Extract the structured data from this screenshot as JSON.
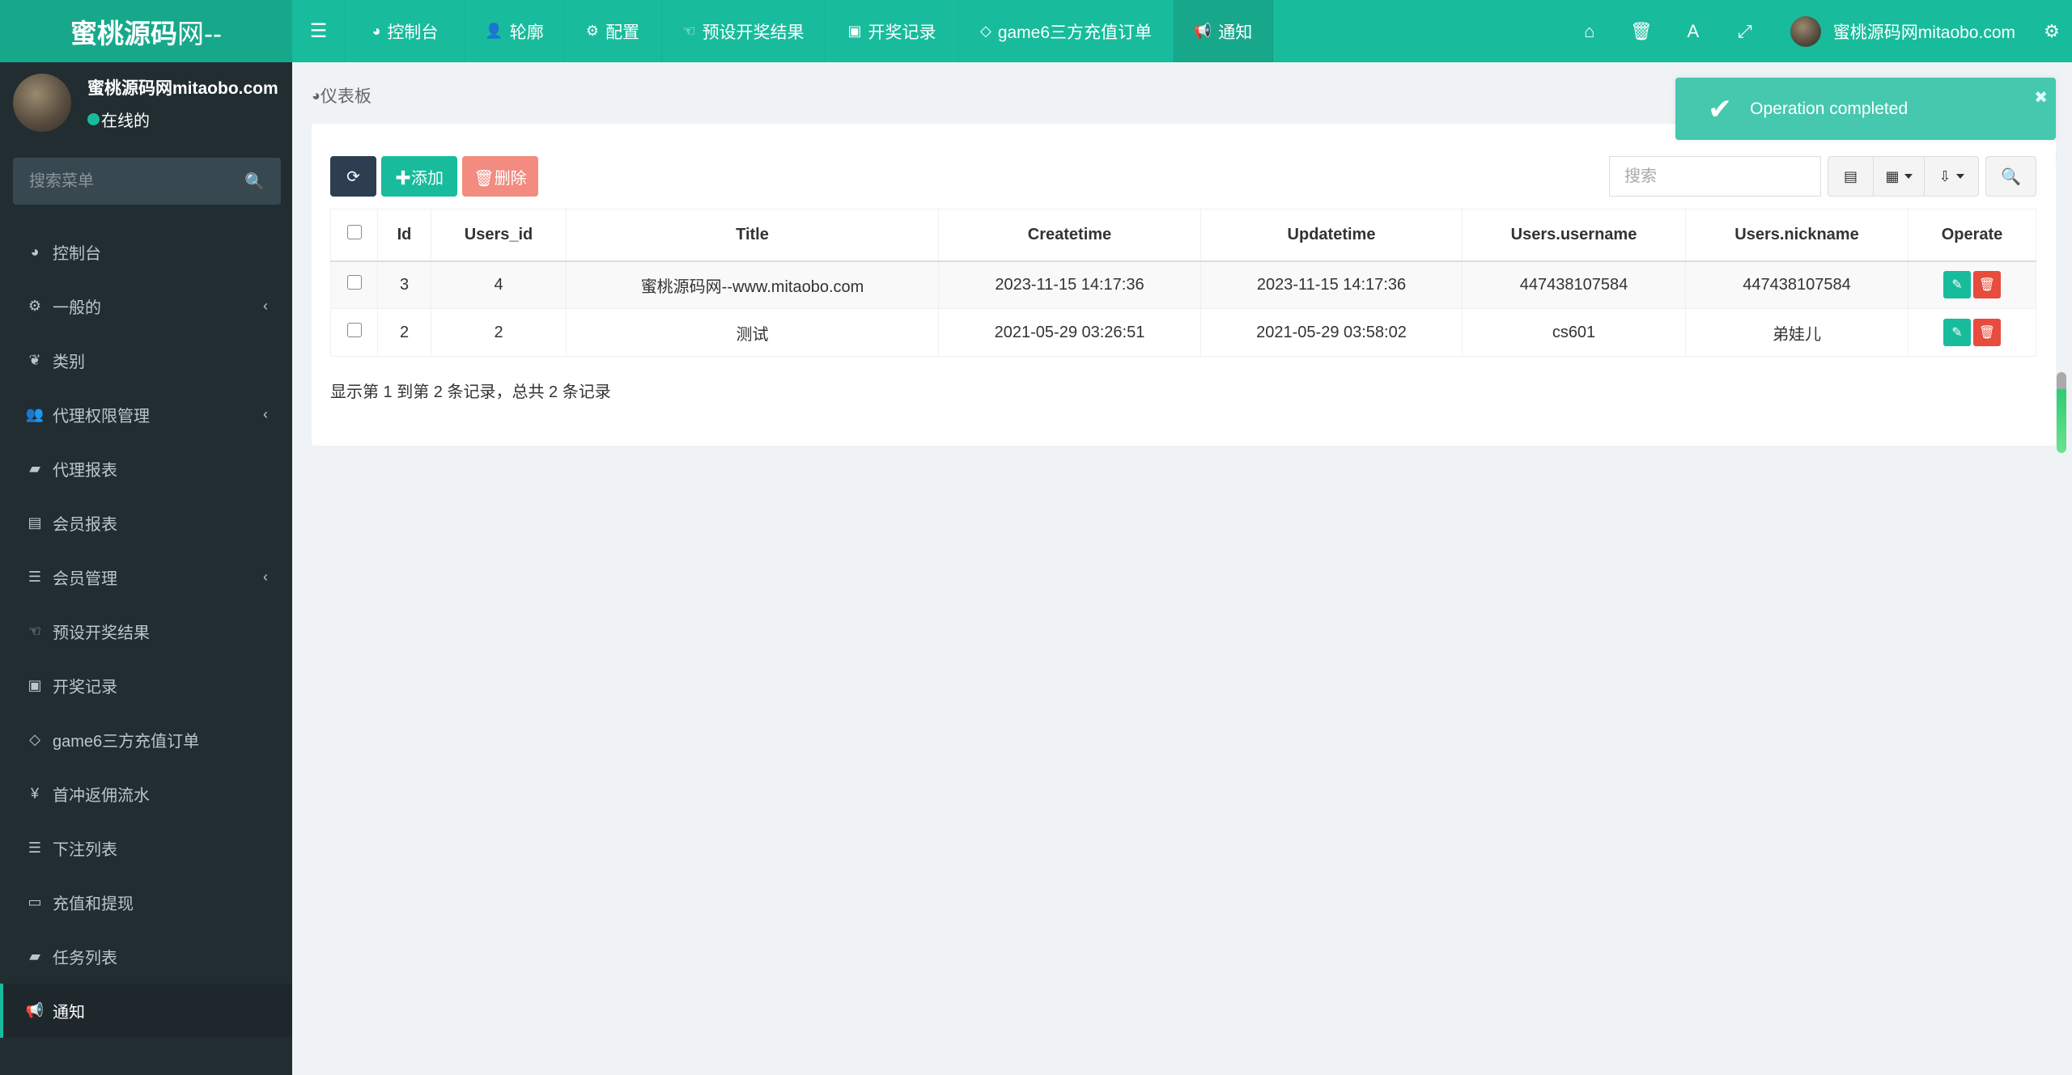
{
  "header": {
    "logo_bold": "蜜桃源码",
    "logo_thin": "网--",
    "nav": [
      {
        "icon": "dashboard-icon",
        "glyph": "◕",
        "label": "控制台"
      },
      {
        "icon": "user-icon",
        "glyph": "👤",
        "label": "轮廓"
      },
      {
        "icon": "gear-icon",
        "glyph": "⚙",
        "label": "配置"
      },
      {
        "icon": "hand-icon",
        "glyph": "☜",
        "label": "预设开奖结果"
      },
      {
        "icon": "calendar-check-icon",
        "glyph": "▣",
        "label": "开奖记录"
      },
      {
        "icon": "diamond-icon",
        "glyph": "◇",
        "label": "game6三方充值订单"
      },
      {
        "icon": "bullhorn-icon",
        "glyph": "📢",
        "label": "通知",
        "active": true
      }
    ],
    "right_icons": [
      {
        "icon": "home-icon",
        "glyph": "⌂"
      },
      {
        "icon": "trash-icon",
        "glyph": "🗑"
      },
      {
        "icon": "translate-icon",
        "glyph": "A"
      },
      {
        "icon": "fullscreen-icon",
        "glyph": "⤢"
      }
    ],
    "user_name": "蜜桃源码网mitaobo.com",
    "settings_icon": "gears-icon"
  },
  "sidebar": {
    "user_name": "蜜桃源码网mitaobo.com",
    "status": "在线的",
    "search_placeholder": "搜索菜单",
    "items": [
      {
        "icon": "dashboard-icon",
        "glyph": "◕",
        "label": "控制台"
      },
      {
        "icon": "gears-icon",
        "glyph": "⚙",
        "label": "一般的",
        "has_children": true
      },
      {
        "icon": "leaf-icon",
        "glyph": "❦",
        "label": "类别"
      },
      {
        "icon": "users-icon",
        "glyph": "👥",
        "label": "代理权限管理",
        "has_children": true
      },
      {
        "icon": "book-icon",
        "glyph": "▰",
        "label": "代理报表"
      },
      {
        "icon": "address-book-icon",
        "glyph": "▤",
        "label": "会员报表"
      },
      {
        "icon": "list-icon",
        "glyph": "☰",
        "label": "会员管理",
        "has_children": true
      },
      {
        "icon": "hand-icon",
        "glyph": "☜",
        "label": "预设开奖结果"
      },
      {
        "icon": "calendar-check-icon",
        "glyph": "▣",
        "label": "开奖记录"
      },
      {
        "icon": "diamond-icon",
        "glyph": "◇",
        "label": "game6三方充值订单"
      },
      {
        "icon": "yen-icon",
        "glyph": "¥",
        "label": "首冲返佣流水"
      },
      {
        "icon": "list-icon",
        "glyph": "☰",
        "label": "下注列表"
      },
      {
        "icon": "money-icon",
        "glyph": "▭",
        "label": "充值和提现"
      },
      {
        "icon": "book-icon",
        "glyph": "▰",
        "label": "任务列表"
      },
      {
        "icon": "bullhorn-icon",
        "glyph": "📢",
        "label": "通知",
        "active": true
      }
    ]
  },
  "breadcrumb": {
    "label": "仪表板",
    "ghost": "通知"
  },
  "toolbar": {
    "refresh_glyph": "⟳",
    "add_label": "✚添加",
    "delete_label": "🗑删除",
    "search_placeholder": "搜索",
    "search_glyph": "🔍"
  },
  "table": {
    "columns": [
      "Id",
      "Users_id",
      "Title",
      "Createtime",
      "Updatetime",
      "Users.username",
      "Users.nickname",
      "Operate"
    ],
    "rows": [
      {
        "id": "3",
        "users_id": "4",
        "title": "蜜桃源码网--www.mitaobo.com",
        "createtime": "2023-11-15 14:17:36",
        "updatetime": "2023-11-15 14:17:36",
        "username": "447438107584",
        "nickname": "447438107584"
      },
      {
        "id": "2",
        "users_id": "2",
        "title": "测试",
        "createtime": "2021-05-29 03:26:51",
        "updatetime": "2021-05-29 03:58:02",
        "username": "cs601",
        "nickname": "弟娃儿"
      }
    ],
    "footer": "显示第 1 到第 2 条记录，总共 2 条记录"
  },
  "toast": {
    "message": "Operation completed",
    "close_glyph": "✖",
    "check_glyph": "✔"
  },
  "colors": {
    "primary": "#18bc9c",
    "logo_bg": "#17a88b",
    "sidebar_bg": "#222d32",
    "danger": "#e74c3c",
    "dark_btn": "#2c3e50"
  }
}
